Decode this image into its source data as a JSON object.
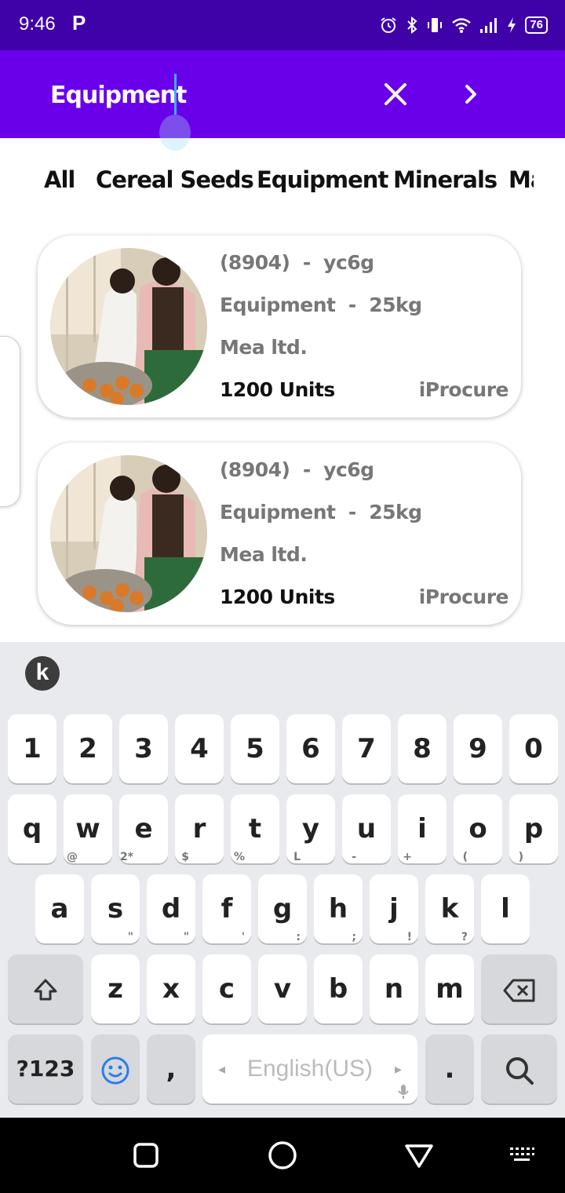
{
  "status": {
    "time": "9:46",
    "app_badge": "P",
    "battery": "76"
  },
  "search": {
    "value": "Equipment"
  },
  "tabs": [
    "All",
    "Cereal Seeds",
    "Equipment",
    "Minerals",
    "Ma"
  ],
  "products": [
    {
      "code": "(8904)",
      "sep1": "-",
      "sku": "yc6g",
      "category": "Equipment",
      "sep2": "-",
      "weight": "25kg",
      "company": "Mea ltd.",
      "units": "1200 Units",
      "source": "iProcure"
    },
    {
      "code": "(8904)",
      "sep1": "-",
      "sku": "yc6g",
      "category": "Equipment",
      "sep2": "-",
      "weight": "25kg",
      "company": "Mea ltd.",
      "units": "1200 Units",
      "source": "iProcure"
    }
  ],
  "keyboard": {
    "logo": "k",
    "row1": [
      "1",
      "2",
      "3",
      "4",
      "5",
      "6",
      "7",
      "8",
      "9",
      "0"
    ],
    "row2": [
      "q",
      "w",
      "e",
      "r",
      "t",
      "y",
      "u",
      "i",
      "o",
      "p"
    ],
    "row3": [
      "a",
      "s",
      "d",
      "f",
      "g",
      "h",
      "j",
      "k",
      "l"
    ],
    "row3_hints": [
      "@",
      "2*",
      "$",
      "%",
      "L",
      "-",
      "+",
      "(",
      ")"
    ],
    "row4": [
      "z",
      "x",
      "c",
      "v",
      "b",
      "n",
      "m"
    ],
    "row4_hints": [
      "\"",
      "\"",
      "'",
      ":",
      ";",
      "!",
      "?"
    ],
    "symbols_label": "?123",
    "comma_label": ",",
    "period_label": ".",
    "space_label": "English(US)"
  },
  "icons": {
    "status": [
      "alarm-icon",
      "bluetooth-icon",
      "vibrate-icon",
      "wifi-icon",
      "signal-icon",
      "charging-icon"
    ],
    "header": [
      "close-icon",
      "chevron-right-icon"
    ],
    "keyboard": [
      "shift-icon",
      "backspace-icon",
      "emoji-icon",
      "search-icon",
      "mic-icon"
    ],
    "nav": [
      "recents-icon",
      "home-icon",
      "back-icon",
      "keyboard-switch-icon"
    ]
  },
  "colors": {
    "status_bar": "#3f02a8",
    "header": "#6a00ea",
    "keyboard_bg": "#e8eaed"
  }
}
